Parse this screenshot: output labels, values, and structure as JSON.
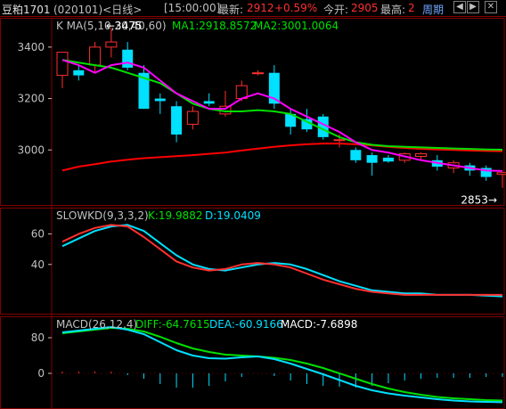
{
  "titlebar": {
    "symbol": "豆粕1701",
    "code_period": "(020101)<日线>",
    "time": "[15:00:00]",
    "latest_label": "最新:",
    "latest_value": "2912",
    "change_pct": "+0.59%",
    "open_label": "今开:",
    "open_value": "2905",
    "high_label": "最高:",
    "high_value": "2",
    "period_label": "周期"
  },
  "colors": {
    "up": "#ff3030",
    "down": "#00e0ff",
    "ma_pink": "#ff00ff",
    "ma_green": "#00e000",
    "ma_red": "#ff0000",
    "k_line": "#ff3030",
    "d_line": "#00e0ff",
    "panel_border": "#800000",
    "grid": "#800000"
  },
  "main_panel": {
    "title": "K  MA(5,10,20,40,60)",
    "ma1_label": "MA1:2918.8572",
    "ma2_label": "MA2:3001.0064",
    "y_ticks": [
      "3400",
      "3200",
      "3000"
    ],
    "high_annotation": "←3475",
    "low_annotation": "2853→"
  },
  "kd_panel": {
    "title": "SLOWKD(9,3,3,2)",
    "k_label": "K:19.9882",
    "d_label": "D:19.0409",
    "y_ticks": [
      "60",
      "40"
    ]
  },
  "macd_panel": {
    "title": "MACD(26,12,4)",
    "diff_label": "DIFF:-64.7615",
    "dea_label": "DEA:-60.9166",
    "macd_label": "MACD:-7.6898",
    "y_ticks": [
      "80",
      "0"
    ]
  },
  "chart_data": {
    "type": "candlestick",
    "candles": [
      {
        "o": 3290,
        "h": 3340,
        "l": 3240,
        "c": 3380
      },
      {
        "o": 3310,
        "h": 3330,
        "l": 3270,
        "c": 3290
      },
      {
        "o": 3330,
        "h": 3420,
        "l": 3300,
        "c": 3400
      },
      {
        "o": 3400,
        "h": 3475,
        "l": 3360,
        "c": 3420
      },
      {
        "o": 3390,
        "h": 3420,
        "l": 3310,
        "c": 3320
      },
      {
        "o": 3300,
        "h": 3330,
        "l": 3200,
        "c": 3160
      },
      {
        "o": 3200,
        "h": 3220,
        "l": 3140,
        "c": 3190
      },
      {
        "o": 3170,
        "h": 3190,
        "l": 3030,
        "c": 3060
      },
      {
        "o": 3100,
        "h": 3170,
        "l": 3080,
        "c": 3150
      },
      {
        "o": 3190,
        "h": 3220,
        "l": 3170,
        "c": 3180
      },
      {
        "o": 3140,
        "h": 3230,
        "l": 3130,
        "c": 3170
      },
      {
        "o": 3200,
        "h": 3270,
        "l": 3190,
        "c": 3250
      },
      {
        "o": 3300,
        "h": 3310,
        "l": 3290,
        "c": 3300
      },
      {
        "o": 3300,
        "h": 3330,
        "l": 3160,
        "c": 3180
      },
      {
        "o": 3140,
        "h": 3160,
        "l": 3060,
        "c": 3090
      },
      {
        "o": 3120,
        "h": 3160,
        "l": 3070,
        "c": 3080
      },
      {
        "o": 3130,
        "h": 3140,
        "l": 3040,
        "c": 3050
      },
      {
        "o": 3040,
        "h": 3060,
        "l": 3010,
        "c": 3040
      },
      {
        "o": 3000,
        "h": 3010,
        "l": 2950,
        "c": 2960
      },
      {
        "o": 2980,
        "h": 2990,
        "l": 2900,
        "c": 2950
      },
      {
        "o": 2970,
        "h": 2980,
        "l": 2950,
        "c": 2955
      },
      {
        "o": 2960,
        "h": 2990,
        "l": 2950,
        "c": 2985
      },
      {
        "o": 2975,
        "h": 2990,
        "l": 2960,
        "c": 2985
      },
      {
        "o": 2960,
        "h": 2980,
        "l": 2920,
        "c": 2935
      },
      {
        "o": 2930,
        "h": 2960,
        "l": 2910,
        "c": 2950
      },
      {
        "o": 2940,
        "h": 2950,
        "l": 2900,
        "c": 2920
      },
      {
        "o": 2930,
        "h": 2940,
        "l": 2880,
        "c": 2895
      },
      {
        "o": 2905,
        "h": 2915,
        "l": 2853,
        "c": 2912
      }
    ],
    "ma_fast": [
      3350,
      3330,
      3300,
      3330,
      3340,
      3320,
      3270,
      3220,
      3190,
      3160,
      3160,
      3200,
      3220,
      3200,
      3160,
      3130,
      3100,
      3070,
      3030,
      3000,
      2990,
      2975,
      2960,
      2950,
      2940,
      2930,
      2920,
      2918
    ],
    "ma_mid": [
      3350,
      3340,
      3330,
      3320,
      3300,
      3280,
      3260,
      3220,
      3180,
      3160,
      3150,
      3150,
      3155,
      3150,
      3140,
      3110,
      3080,
      3050,
      3030,
      3020,
      3015,
      3012,
      3010,
      3008,
      3006,
      3004,
      3002,
      3001
    ],
    "ma_slow": [
      2920,
      2935,
      2945,
      2955,
      2962,
      2968,
      2972,
      2976,
      2980,
      2985,
      2990,
      2998,
      3005,
      3012,
      3018,
      3022,
      3025,
      3025,
      3022,
      3018,
      3012,
      3008,
      3004,
      3002,
      3000,
      2998,
      2996,
      2995
    ],
    "kd_k": [
      55,
      60,
      64,
      66,
      65,
      58,
      50,
      42,
      38,
      36,
      37,
      40,
      41,
      40,
      38,
      34,
      30,
      27,
      24,
      22,
      21,
      20,
      20,
      20,
      20,
      20,
      20,
      19.9882
    ],
    "kd_d": [
      52,
      57,
      62,
      65,
      66,
      62,
      54,
      46,
      40,
      37,
      36,
      38,
      40,
      41,
      40,
      37,
      33,
      29,
      26,
      23,
      22,
      21,
      21,
      20,
      20,
      20,
      19.5,
      19.0409
    ],
    "macd_diff": [
      92,
      96,
      100,
      104,
      98,
      88,
      70,
      52,
      40,
      34,
      33,
      36,
      38,
      32,
      22,
      10,
      -2,
      -15,
      -28,
      -38,
      -45,
      -50,
      -54,
      -58,
      -61,
      -63,
      -64,
      -64.7615
    ],
    "macd_dea": [
      90,
      94,
      98,
      102,
      100,
      94,
      82,
      68,
      56,
      48,
      42,
      40,
      38,
      35,
      30,
      22,
      12,
      0,
      -12,
      -24,
      -34,
      -42,
      -48,
      -53,
      -56,
      -58,
      -60,
      -60.9166
    ],
    "macd_hist": [
      4,
      4,
      4,
      4,
      -4,
      -12,
      -24,
      -32,
      -32,
      -28,
      -18,
      -8,
      0,
      -6,
      -16,
      -24,
      -28,
      -30,
      -32,
      -28,
      -22,
      -16,
      -12,
      -10,
      -10,
      -10,
      -8,
      -7.6898
    ],
    "ylim_main": [
      2800,
      3500
    ],
    "ylim_kd": [
      10,
      75
    ],
    "ylim_macd": [
      -70,
      120
    ]
  }
}
